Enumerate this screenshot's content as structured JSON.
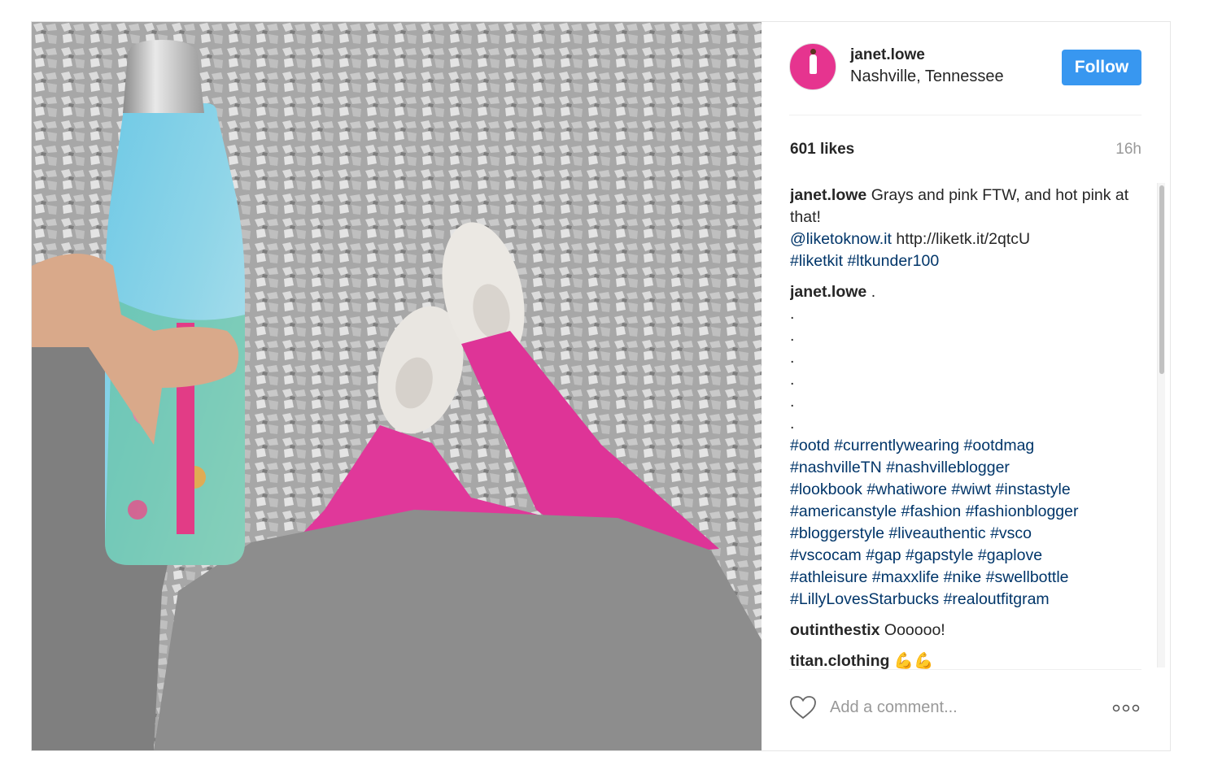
{
  "post": {
    "user": {
      "username": "janet.lowe",
      "location": "Nashville, Tennessee"
    },
    "follow_label": "Follow",
    "likes": "601 likes",
    "time": "16h",
    "caption": {
      "user": "janet.lowe",
      "text": " Grays and pink FTW, and hot pink at that!",
      "mention": "@liketoknow.it",
      "url": "http://liketk.it/2qtcU",
      "tags_line": "#liketkit #ltkunder100"
    },
    "comment2": {
      "user": "janet.lowe",
      "text": " .",
      "dots": [
        ".",
        ".",
        ".",
        ".",
        ".",
        "."
      ],
      "hashtags": [
        "#ootd #currentlywearing #ootdmag",
        "#nashvilleTN #nashvilleblogger",
        "#lookbook #whatiwore #wiwt #instastyle",
        "#americanstyle #fashion #fashionblogger",
        "#bloggerstyle #liveauthentic #vsco",
        "#vscocam #gap #gapstyle #gaplove",
        "#athleisure #maxxlife #nike #swellbottle",
        "#LillyLovesStarbucks #realoutfitgram"
      ]
    },
    "comment3": {
      "user": "outinthestix",
      "text": " Oooooo!"
    },
    "comment4": {
      "user": "titan.clothing",
      "text": " 💪💪"
    },
    "add_comment_placeholder": "Add a comment...",
    "more_options": "ooo",
    "icons": {
      "like": "heart-icon",
      "more": "more-options-icon"
    },
    "colors": {
      "follow_button": "#3897f0",
      "link": "#003569",
      "leggings": "#e0389a"
    }
  }
}
